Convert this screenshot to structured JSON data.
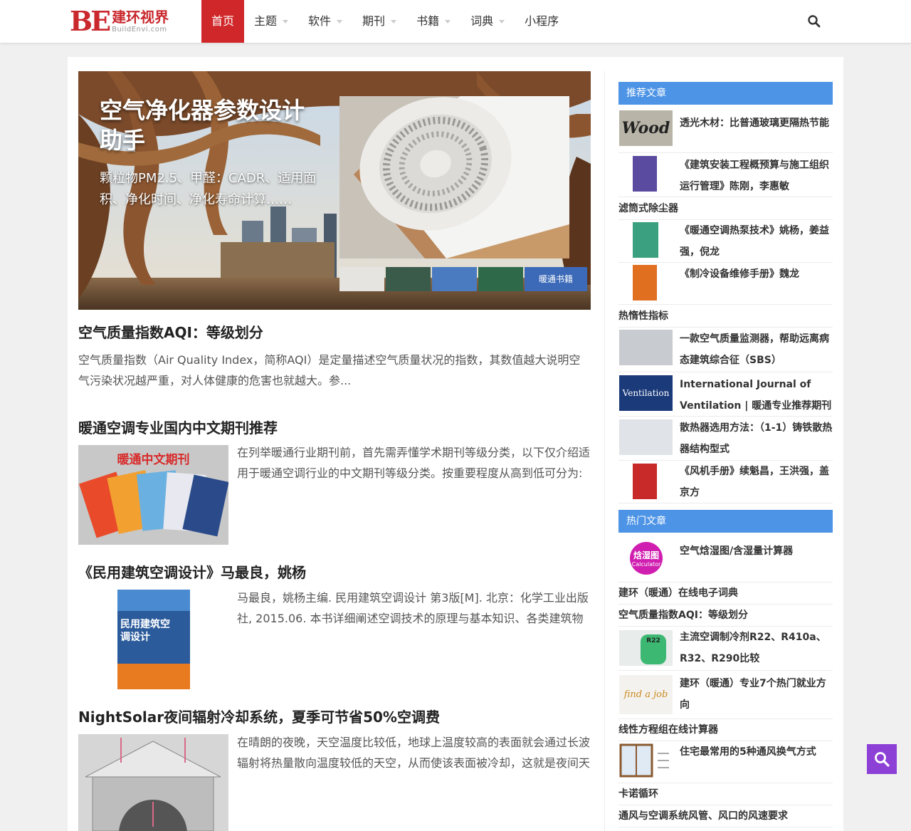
{
  "header": {
    "logo_mark": "BE",
    "logo_cn": "建环视界",
    "logo_en": "BuildEnvi.com",
    "nav": [
      {
        "label": "首页",
        "active": true,
        "dropdown": false
      },
      {
        "label": "主题",
        "active": false,
        "dropdown": true
      },
      {
        "label": "软件",
        "active": false,
        "dropdown": true
      },
      {
        "label": "期刊",
        "active": false,
        "dropdown": true
      },
      {
        "label": "书籍",
        "active": false,
        "dropdown": true
      },
      {
        "label": "词典",
        "active": false,
        "dropdown": true
      },
      {
        "label": "小程序",
        "active": false,
        "dropdown": false
      }
    ],
    "search_icon": "search-icon"
  },
  "hero": {
    "title": "空气净化器参数设计助手",
    "subtitle": "颗粒物PM2.5、甲醛：CADR、适用面积、净化时间、净化寿命计算……",
    "thumb_last_label": "暖通书籍"
  },
  "articles": [
    {
      "title": "空气质量指数AQI：等级划分",
      "excerpt": "空气质量指数（Air Quality Index，简称AQI）是定量描述空气质量状况的指数，其数值越大说明空气污染状况越严重，对人体健康的危害也就越大。参..."
    },
    {
      "title": "暖通空调专业国内中文期刊推荐",
      "excerpt": "在列举暖通行业期刊前，首先需弄懂学术期刊等级分类，以下仅介绍适用于暖通空调行业的中文期刊等级分类。按重要程度从高到低可分为:",
      "thumb_label": "暖通中文期刊"
    },
    {
      "title": "《民用建筑空调设计》马最良，姚杨",
      "excerpt": "马最良，姚杨主编. 民用建筑空调设计 第3版[M]. 北京：化学工业出版社, 2015.06. 本书详细阐述空调技术的原理与基本知识、各类建筑物",
      "thumb_label": "民用建筑空调设计"
    },
    {
      "title": "NightSolar夜间辐射冷却系统，夏季可节省50%空调费",
      "excerpt": "在晴朗的夜晚，天空温度比较低，地球上温度较高的表面就会通过长波辐射将热量散向温度较低的天空，从而使该表面被冷却，这就是夜间天"
    }
  ],
  "sidebar": {
    "recommended_title": "推荐文章",
    "recommended": [
      {
        "type": "thumb",
        "text": "透光木材：比普通玻璃更隔热节能",
        "thumb_label": "Wood"
      },
      {
        "type": "thumb",
        "text": "《建筑安装工程概预算与施工组织运行管理》陈刚，李惠敏"
      },
      {
        "type": "plain",
        "text": "滤筒式除尘器"
      },
      {
        "type": "thumb",
        "text": "《暖通空调热泵技术》姚杨，姜益强，倪龙"
      },
      {
        "type": "thumb",
        "text": "《制冷设备维修手册》魏龙"
      },
      {
        "type": "plain",
        "text": "热惰性指标"
      },
      {
        "type": "thumb",
        "text": "一款空气质量监测器，帮助远离病态建筑综合征（SBS）"
      },
      {
        "type": "thumb",
        "text": "International Journal of Ventilation | 暖通专业推荐期刊",
        "thumb_label": "Ventilation"
      },
      {
        "type": "thumb",
        "text": "散热器选用方法：（1-1）铸铁散热器结构型式"
      },
      {
        "type": "thumb",
        "text": "《风机手册》续魁昌，王洪强，盖京方"
      }
    ],
    "popular_title": "热门文章",
    "popular": [
      {
        "type": "thumb",
        "text": "空气焓湿图/含湿量计算器",
        "thumb_label": "焓湿图",
        "thumb_sub": "Calculator"
      },
      {
        "type": "plain",
        "text": "建环（暖通）在线电子词典"
      },
      {
        "type": "plain",
        "text": "空气质量指数AQI：等级划分"
      },
      {
        "type": "thumb",
        "text": "主流空调制冷剂R22、R410a、R32、R290比较",
        "thumb_label": "R22"
      },
      {
        "type": "thumb",
        "text": "建环（暖通）专业7个热门就业方向",
        "thumb_label": "find a job"
      },
      {
        "type": "plain",
        "text": "线性方程组在线计算器"
      },
      {
        "type": "thumb",
        "text": "住宅最常用的5种通风换气方式"
      },
      {
        "type": "plain",
        "text": "卡诺循环"
      },
      {
        "type": "plain",
        "text": "通风与空调系统风管、风口的风速要求"
      }
    ]
  },
  "floating_search_icon": "search-icon"
}
